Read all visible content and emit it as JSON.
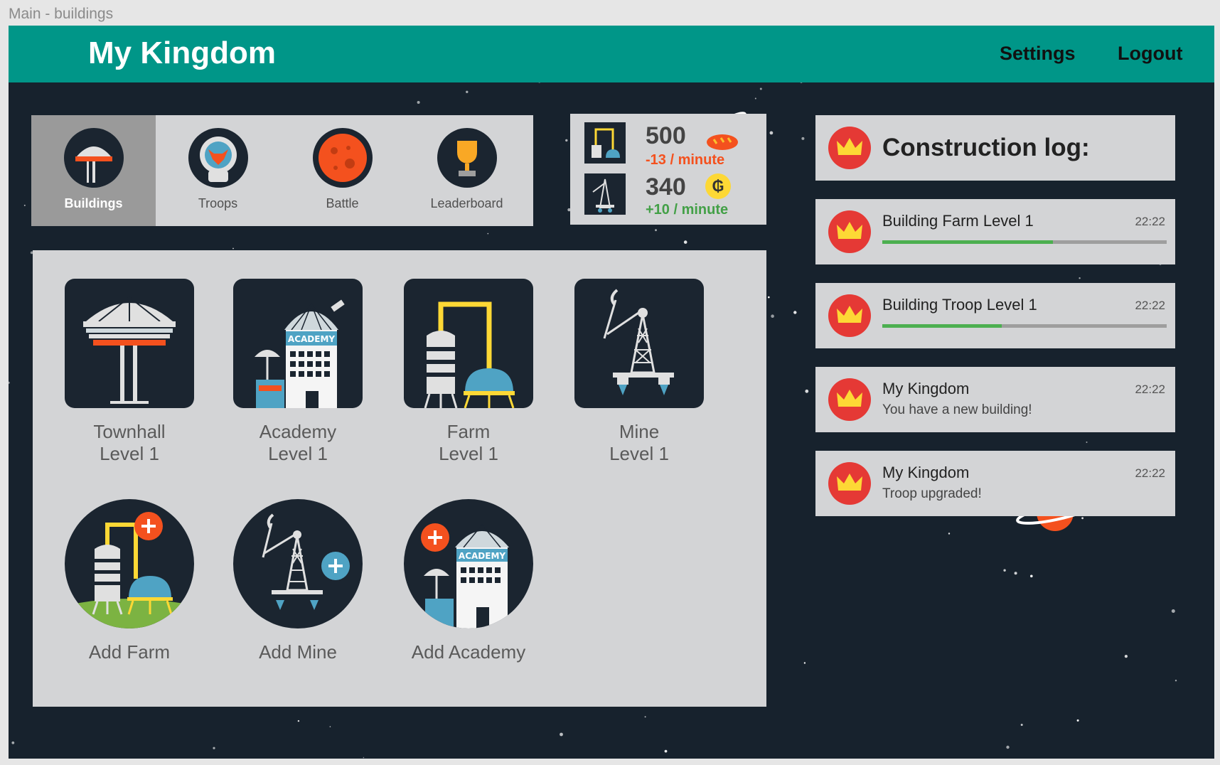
{
  "window": {
    "title": "Main - buildings"
  },
  "header": {
    "app_title": "My Kingdom",
    "settings_label": "Settings",
    "logout_label": "Logout"
  },
  "tabs": [
    {
      "label": "Buildings",
      "icon": "buildings-icon",
      "active": true
    },
    {
      "label": "Troops",
      "icon": "troops-icon",
      "active": false
    },
    {
      "label": "Battle",
      "icon": "battle-icon",
      "active": false
    },
    {
      "label": "Leaderboard",
      "icon": "leaderboard-icon",
      "active": false
    }
  ],
  "resources": {
    "food": {
      "amount": "500",
      "rate": "-13 / minute",
      "icon": "bread-icon",
      "rate_color": "#f4511e"
    },
    "gold": {
      "amount": "340",
      "rate": "+10 / minute",
      "icon": "gold-coin-icon",
      "coin_symbol": "₲",
      "rate_color": "#43a047"
    }
  },
  "buildings": [
    {
      "name": "Townhall",
      "level": "Level 1",
      "icon": "townhall-icon"
    },
    {
      "name": "Academy",
      "level": "Level 1",
      "icon": "academy-icon"
    },
    {
      "name": "Farm",
      "level": "Level 1",
      "icon": "farm-icon"
    },
    {
      "name": "Mine",
      "level": "Level 1",
      "icon": "mine-icon"
    }
  ],
  "academy_sign": "ACADEMY",
  "add_buttons": [
    {
      "label": "Add Farm",
      "icon": "add-farm-icon"
    },
    {
      "label": "Add Mine",
      "icon": "add-mine-icon"
    },
    {
      "label": "Add Academy",
      "icon": "add-academy-icon"
    }
  ],
  "construction_log": {
    "title": "Construction log:",
    "entries": [
      {
        "title": "Building Farm Level 1",
        "time": "22:22",
        "progress": 0.6
      },
      {
        "title": "Building Troop Level 1",
        "time": "22:22",
        "progress": 0.42
      },
      {
        "title": "My Kingdom",
        "subtitle": "You have a new building!",
        "time": "22:22"
      },
      {
        "title": "My Kingdom",
        "subtitle": "Troop upgraded!",
        "time": "22:22"
      }
    ]
  },
  "colors": {
    "header": "#009688",
    "background": "#17222d",
    "panel": "#d3d4d6",
    "active_tab": "#9a9a9a",
    "crown_bg": "#e53935",
    "progress": "#4caf50"
  }
}
